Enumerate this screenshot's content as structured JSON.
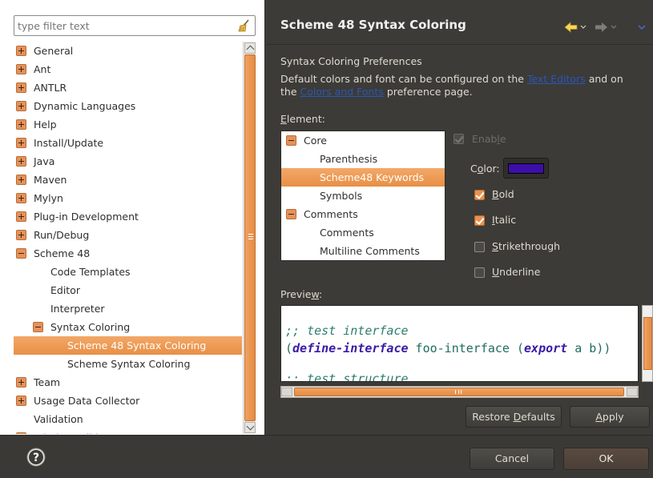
{
  "filter": {
    "placeholder": "type filter text"
  },
  "tree": {
    "items": [
      {
        "label": "General",
        "level": 0,
        "expander": "plus"
      },
      {
        "label": "Ant",
        "level": 0,
        "expander": "plus"
      },
      {
        "label": "ANTLR",
        "level": 0,
        "expander": "plus"
      },
      {
        "label": "Dynamic Languages",
        "level": 0,
        "expander": "plus"
      },
      {
        "label": "Help",
        "level": 0,
        "expander": "plus"
      },
      {
        "label": "Install/Update",
        "level": 0,
        "expander": "plus"
      },
      {
        "label": "Java",
        "level": 0,
        "expander": "plus"
      },
      {
        "label": "Maven",
        "level": 0,
        "expander": "plus"
      },
      {
        "label": "Mylyn",
        "level": 0,
        "expander": "plus"
      },
      {
        "label": "Plug-in Development",
        "level": 0,
        "expander": "plus"
      },
      {
        "label": "Run/Debug",
        "level": 0,
        "expander": "plus"
      },
      {
        "label": "Scheme 48",
        "level": 0,
        "expander": "minus"
      },
      {
        "label": "Code Templates",
        "level": 1,
        "expander": "none"
      },
      {
        "label": "Editor",
        "level": 1,
        "expander": "none"
      },
      {
        "label": "Interpreter",
        "level": 1,
        "expander": "none"
      },
      {
        "label": "Syntax Coloring",
        "level": 1,
        "expander": "minus"
      },
      {
        "label": "Scheme 48 Syntax Coloring",
        "level": 2,
        "expander": "none",
        "selected": true
      },
      {
        "label": "Scheme Syntax Coloring",
        "level": 2,
        "expander": "none"
      },
      {
        "label": "Team",
        "level": 0,
        "expander": "plus"
      },
      {
        "label": "Usage Data Collector",
        "level": 0,
        "expander": "plus"
      },
      {
        "label": "Validation",
        "level": 0,
        "expander": "none"
      },
      {
        "label": "WindowBuilder",
        "level": 0,
        "expander": "plus"
      }
    ]
  },
  "header": {
    "title": "Scheme 48 Syntax Coloring"
  },
  "description": {
    "title": "Syntax Coloring Preferences",
    "line1_pre": "Default colors and font can be configured on the ",
    "line1_link": "Text Editors",
    "line1_post": " and on",
    "line2_pre": "the ",
    "line2_link": "Colors and Fonts",
    "line2_post": " preference page."
  },
  "element": {
    "label_pre": "",
    "label_mnemonic": "E",
    "label_post": "lement:",
    "items": [
      {
        "label": "Core",
        "level": 0,
        "expander": "minus"
      },
      {
        "label": "Parenthesis",
        "level": 1,
        "expander": "none"
      },
      {
        "label": "Scheme48 Keywords",
        "level": 1,
        "expander": "none",
        "selected": true
      },
      {
        "label": "Symbols",
        "level": 1,
        "expander": "none"
      },
      {
        "label": "Comments",
        "level": 0,
        "expander": "minus"
      },
      {
        "label": "Comments",
        "level": 1,
        "expander": "none"
      },
      {
        "label": "Multiline Comments",
        "level": 1,
        "expander": "none"
      }
    ]
  },
  "options": {
    "enable": {
      "pre": "Enab",
      "mn": "l",
      "post": "e",
      "checked": true,
      "disabled": true
    },
    "color": {
      "pre": "C",
      "mn": "o",
      "post": "lor:",
      "value": "#3c0fa8"
    },
    "bold": {
      "pre": "",
      "mn": "B",
      "post": "old",
      "checked": true
    },
    "italic": {
      "pre": "",
      "mn": "I",
      "post": "talic",
      "checked": true
    },
    "strikethrough": {
      "pre": "",
      "mn": "S",
      "post": "trikethrough",
      "checked": false
    },
    "underline": {
      "pre": "",
      "mn": "U",
      "post": "nderline",
      "checked": false
    }
  },
  "preview": {
    "label_pre": "Previe",
    "label_mn": "w",
    "label_post": ":",
    "line1": ";; test interface",
    "line2_open": "(",
    "line2_kw1": "define-interface",
    "line2_mid": " foo-interface (",
    "line2_kw2": "export",
    "line2_end": " a b))",
    "line3": ";; test structure"
  },
  "buttons": {
    "restore_pre": "Restore ",
    "restore_mn": "D",
    "restore_post": "efaults",
    "apply_mn": "A",
    "apply_post": "pply",
    "cancel": "Cancel",
    "ok": "OK"
  }
}
